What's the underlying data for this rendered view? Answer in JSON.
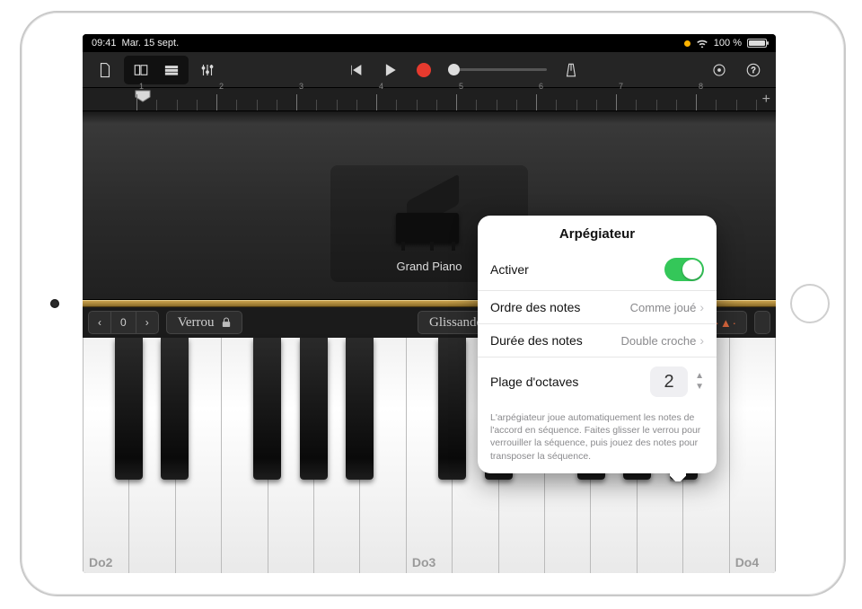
{
  "status": {
    "time": "09:41",
    "date": "Mar. 15 sept.",
    "battery_pct": "100 %",
    "location_indicator": true
  },
  "toolbar": {
    "icons": {
      "projects": "document-icon",
      "tracks": "tracks-icon",
      "loop_browser": "loop-browser-icon",
      "mixer": "mixer-icon",
      "rewind": "rewind-icon",
      "play": "play-icon",
      "record": "record-icon",
      "metronome": "metronome-icon",
      "settings": "settings-icon",
      "help": "help-icon"
    }
  },
  "ruler": {
    "bars": [
      "1",
      "2",
      "3",
      "4",
      "5",
      "6",
      "7",
      "8"
    ],
    "playhead_bar": 1
  },
  "instrument": {
    "name": "Grand Piano"
  },
  "key_controls": {
    "octave_value": "0",
    "verrou_label": "Verrou",
    "glissando_label": "Glissando"
  },
  "keyboard": {
    "labels": {
      "c2": "Do2",
      "c3": "Do3",
      "c4": "Do4"
    }
  },
  "popover": {
    "title": "Arpégiateur",
    "enable_label": "Activer",
    "enable_on": true,
    "note_order": {
      "label": "Ordre des notes",
      "value": "Comme joué"
    },
    "note_length": {
      "label": "Durée des notes",
      "value": "Double croche"
    },
    "octave_range": {
      "label": "Plage d'octaves",
      "value": "2"
    },
    "description": "L'arpégiateur joue automatiquement les notes de l'accord en séquence. Faites glisser le verrou pour verrouiller la séquence, puis jouez des notes pour transposer la séquence."
  }
}
